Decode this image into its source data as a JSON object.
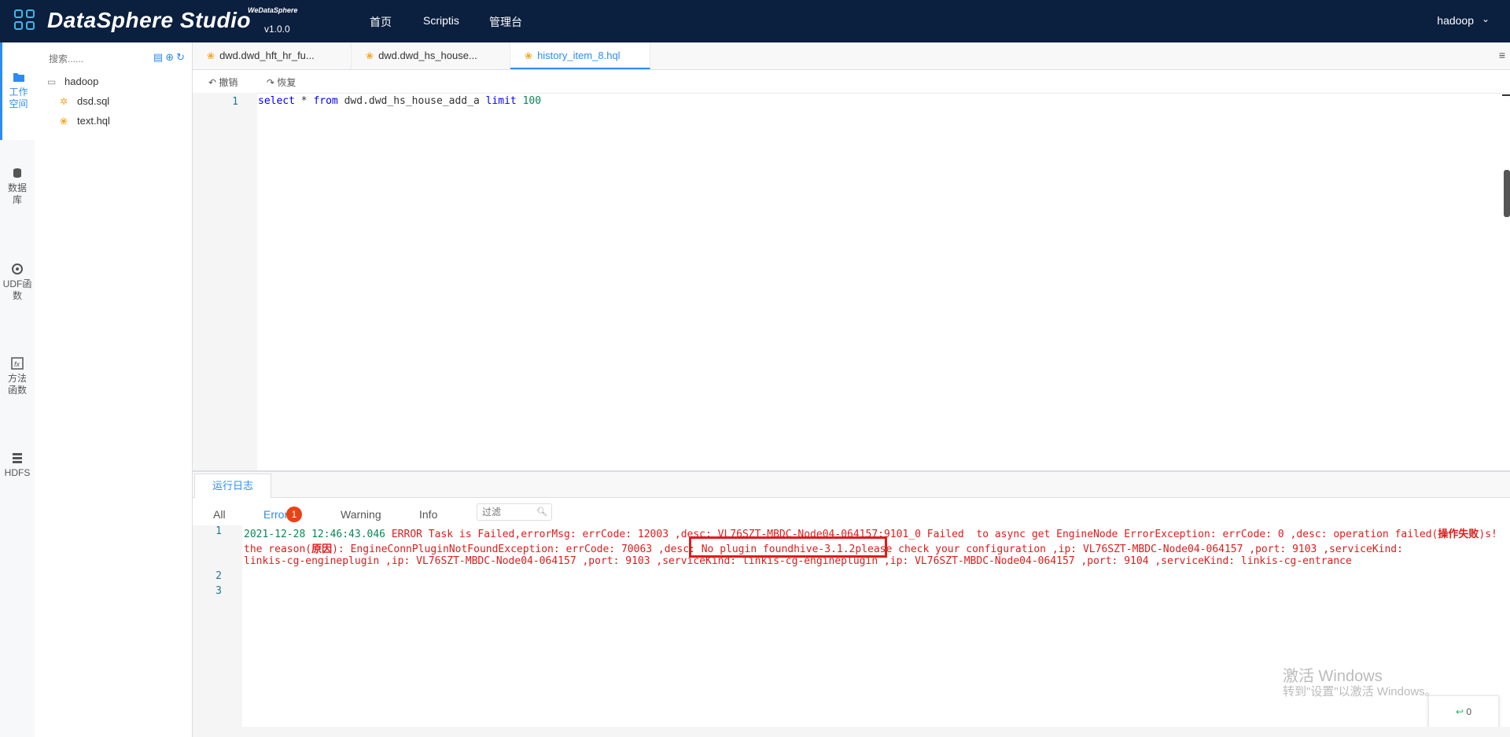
{
  "header": {
    "logo_text": "DataSphere Studio",
    "logo_sup": "WeDataSphere",
    "version": "v1.0.0",
    "nav": [
      "首页",
      "Scriptis",
      "管理台"
    ],
    "user": "hadoop"
  },
  "rail": [
    {
      "label": "工作空间",
      "icon": "folder-icon",
      "active": true
    },
    {
      "label": "数据库",
      "icon": "database-icon"
    },
    {
      "label": "UDF函数",
      "icon": "udf-icon"
    },
    {
      "label": "方法函数",
      "icon": "function-icon"
    },
    {
      "label": "HDFS",
      "icon": "hdfs-icon"
    }
  ],
  "tree": {
    "search_placeholder": "搜索......",
    "root": "hadoop",
    "files": [
      "dsd.sql",
      "text.hql"
    ]
  },
  "tabs": [
    {
      "label": "dwd.dwd_hft_hr_fu...",
      "active": false
    },
    {
      "label": "dwd.dwd_hs_house...",
      "active": false
    },
    {
      "label": "history_item_8.hql",
      "active": true
    }
  ],
  "toolbar": {
    "undo": "撤销",
    "redo": "恢复"
  },
  "editor": {
    "line_numbers": [
      "1"
    ],
    "code": {
      "kw1": "select",
      "t1": " * ",
      "kw2": "from",
      "t2": " dwd.dwd_hs_house_add_a ",
      "kw3": "limit",
      "num": " 100"
    }
  },
  "log": {
    "tab": "运行日志",
    "filters": [
      "All",
      "Error",
      "Warning",
      "Info"
    ],
    "error_count": "1",
    "filter_placeholder": "过滤",
    "line_numbers": [
      "1",
      "2",
      "3"
    ],
    "line1a_ts": "2021-12-28 12:46:43.046",
    "line1a_rest": " ERROR Task is Failed,errorMsg: errCode: 12003 ,desc: VL76SZT-MBDC-Node04-064157:9101_0 Failed  to async get EngineNode ErrorException: errCode: 0 ,desc: operation failed(",
    "line1a_bold": "操作失败",
    "line1a_end": ")s!",
    "line1b_start": "the reason(",
    "line1b_bold": "原因",
    "line1b_rest": "): EngineConnPluginNotFoundException: errCode: 70063 ,desc: No plugin foundhive-3.1.2please check your configuration ,ip: VL76SZT-MBDC-Node04-064157 ,port: 9103 ,serviceKind:",
    "line1c": "linkis-cg-engineplugin ,ip: VL76SZT-MBDC-Node04-064157 ,port: 9103 ,serviceKind: linkis-cg-engineplugin ,ip: VL76SZT-MBDC-Node04-064157 ,port: 9104 ,serviceKind: linkis-cg-entrance"
  },
  "watermark": {
    "line1": "激活 Windows",
    "line2": "转到\"设置\"以激活 Windows。"
  },
  "float_button": {
    "icon": "↩",
    "count": "0"
  }
}
